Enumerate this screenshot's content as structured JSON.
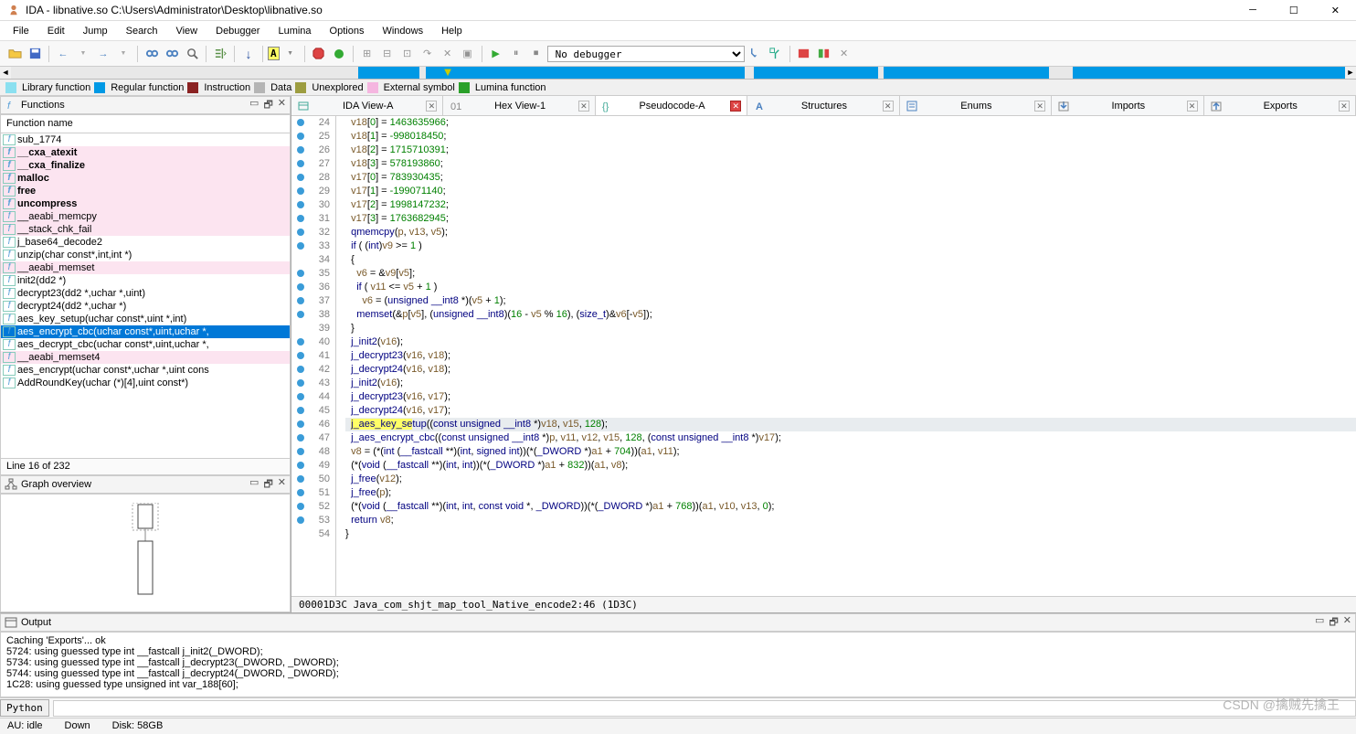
{
  "window": {
    "title": "IDA - libnative.so C:\\Users\\Administrator\\Desktop\\libnative.so"
  },
  "menu": [
    "File",
    "Edit",
    "Jump",
    "Search",
    "View",
    "Debugger",
    "Lumina",
    "Options",
    "Windows",
    "Help"
  ],
  "toolbar": {
    "highlight": "A",
    "dbg_selector": "No debugger"
  },
  "legend": [
    {
      "color": "#8be0f0",
      "label": "Library function"
    },
    {
      "color": "#0099e5",
      "label": "Regular function"
    },
    {
      "color": "#8b2323",
      "label": "Instruction"
    },
    {
      "color": "#b5b5b5",
      "label": "Data"
    },
    {
      "color": "#9d9d40",
      "label": "Unexplored"
    },
    {
      "color": "#f5b6e0",
      "label": "External symbol"
    },
    {
      "color": "#2aa02a",
      "label": "Lumina function"
    }
  ],
  "functions": {
    "title": "Functions",
    "header": "Function name",
    "status": "Line 16 of 232",
    "graph_title": "Graph overview",
    "items": [
      {
        "n": "sub_1774"
      },
      {
        "n": "__cxa_atexit",
        "bold": true,
        "pink": true
      },
      {
        "n": "__cxa_finalize",
        "bold": true,
        "pink": true
      },
      {
        "n": "malloc",
        "bold": true,
        "pink": true
      },
      {
        "n": "free",
        "bold": true,
        "pink": true
      },
      {
        "n": "uncompress",
        "bold": true,
        "pink": true
      },
      {
        "n": "__aeabi_memcpy",
        "pink": true
      },
      {
        "n": "__stack_chk_fail",
        "pink": true
      },
      {
        "n": "j_base64_decode2"
      },
      {
        "n": "unzip(char const*,int,int *)"
      },
      {
        "n": "__aeabi_memset",
        "pink": true
      },
      {
        "n": "init2(dd2 *)"
      },
      {
        "n": "decrypt23(dd2 *,uchar *,uint)"
      },
      {
        "n": "decrypt24(dd2 *,uchar *)"
      },
      {
        "n": "aes_key_setup(uchar const*,uint *,int)"
      },
      {
        "n": "aes_encrypt_cbc(uchar const*,uint,uchar *,",
        "sel": true
      },
      {
        "n": "aes_decrypt_cbc(uchar const*,uint,uchar *,"
      },
      {
        "n": "__aeabi_memset4",
        "pink": true
      },
      {
        "n": "aes_encrypt(uchar const*,uchar *,uint cons"
      },
      {
        "n": "AddRoundKey(uchar (*)[4],uint const*)"
      }
    ]
  },
  "tabs": [
    {
      "label": "IDA View-A",
      "icon": "view"
    },
    {
      "label": "Hex View-1",
      "icon": "hex"
    },
    {
      "label": "Pseudocode-A",
      "icon": "code",
      "active": true,
      "close": "red"
    },
    {
      "label": "Structures",
      "icon": "struct"
    },
    {
      "label": "Enums",
      "icon": "enum"
    },
    {
      "label": "Imports",
      "icon": "import"
    },
    {
      "label": "Exports",
      "icon": "export"
    }
  ],
  "address_bar": "00001D3C Java_com_shjt_map_tool_Native_encode2:46 (1D3C)",
  "code": {
    "start": 24,
    "bp": [
      24,
      25,
      26,
      27,
      28,
      29,
      30,
      31,
      32,
      33,
      35,
      36,
      37,
      38,
      40,
      41,
      42,
      43,
      44,
      45,
      46,
      47,
      48,
      49,
      50,
      51,
      52,
      53
    ],
    "lines": [
      "  <v>v18</v>[<n>0</n>] = <n>1463635966</n>;",
      "  <v>v18</v>[<n>1</n>] = <n>-998018450</n>;",
      "  <v>v18</v>[<n>2</n>] = <n>1715710391</n>;",
      "  <v>v18</v>[<n>3</n>] = <n>578193860</n>;",
      "  <v>v17</v>[<n>0</n>] = <n>783930435</n>;",
      "  <v>v17</v>[<n>1</n>] = <n>-199071140</n>;",
      "  <v>v17</v>[<n>2</n>] = <n>1998147232</n>;",
      "  <v>v17</v>[<n>3</n>] = <n>1763682945</n>;",
      "  <fn>qmemcpy</fn>(<v>p</v>, <v>v13</v>, <v>v5</v>);",
      "  <k>if</k> ( (<t>int</t>)<v>v9</v> >= <n>1</n> )",
      "  {",
      "    <v>v6</v> = &<v>v9</v>[<v>v5</v>];",
      "    <k>if</k> ( <v>v11</v> <= <v>v5</v> + <n>1</n> )",
      "      <v>v6</v> = (<t>unsigned __int8</t> *)(<v>v5</v> + <n>1</n>);",
      "    <fn>memset</fn>(&<v>p</v>[<v>v5</v>], (<t>unsigned __int8</t>)(<n>16</n> - <v>v5</v> % <n>16</n>), (<t>size_t</t>)&<v>v6</v>[-<v>v5</v>]);",
      "  }",
      "  <fn>j_init2</fn>(<v>v16</v>);",
      "  <fn>j_decrypt23</fn>(<v>v16</v>, <v>v18</v>);",
      "  <fn>j_decrypt24</fn>(<v>v16</v>, <v>v18</v>);",
      "  <fn>j_init2</fn>(<v>v16</v>);",
      "  <fn>j_decrypt23</fn>(<v>v16</v>, <v>v17</v>);",
      "  <fn>j_decrypt24</fn>(<v>v16</v>, <v>v17</v>);",
      "  <hly><fn>j_aes_key_se</fn></hly><fn>tup</fn>((<t>const unsigned __int8</t> *)<v>v18</v>, <v>v15</v>, <n>128</n>);",
      "  <fn>j_aes_encrypt_cbc</fn>((<t>const unsigned __int8</t> *)<v>p</v>, <v>v11</v>, <v>v12</v>, <v>v15</v>, <n>128</n>, (<t>const unsigned __int8</t> *)<v>v17</v>);",
      "  <v>v8</v> = (*(<t>int</t> (<t>__fastcall</t> **)(<t>int</t>, <t>signed int</t>))(*(<t>_DWORD</t> *)<v>a1</v> + <n>704</n>))(<v>a1</v>, <v>v11</v>);",
      "  (*(<t>void</t> (<t>__fastcall</t> **)(<t>int</t>, <t>int</t>))(*(<t>_DWORD</t> *)<v>a1</v> + <n>832</n>))(<v>a1</v>, <v>v8</v>);",
      "  <fn>j_free</fn>(<v>v12</v>);",
      "  <fn>j_free</fn>(<v>p</v>);",
      "  (*(<t>void</t> (<t>__fastcall</t> **)(<t>int</t>, <t>int</t>, <t>const void</t> *, <t>_DWORD</t>))(*(<t>_DWORD</t> *)<v>a1</v> + <n>768</n>))(<v>a1</v>, <v>v10</v>, <v>v13</v>, <n>0</n>);",
      "  <k>return</k> <v>v8</v>;",
      "}"
    ]
  },
  "output": {
    "title": "Output",
    "lines": [
      "Caching 'Exports'... ok",
      "5724: using guessed type int __fastcall j_init2(_DWORD);",
      "5734: using guessed type int __fastcall j_decrypt23(_DWORD, _DWORD);",
      "5744: using guessed type int __fastcall j_decrypt24(_DWORD, _DWORD);",
      "1C28: using guessed type unsigned int var_188[60];"
    ],
    "py": "Python"
  },
  "bottom": {
    "a": "AU:  idle",
    "b": "Down",
    "c": "Disk: 58GB"
  },
  "watermark": "CSDN @擒贼先擒王"
}
